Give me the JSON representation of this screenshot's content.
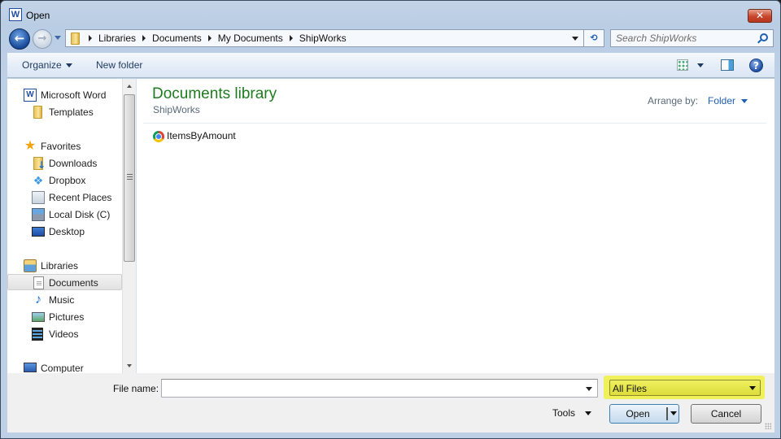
{
  "window": {
    "title": "Open",
    "app_icon": "word-icon",
    "close_label": "✕"
  },
  "navigation": {
    "back_label": "←",
    "forward_label": "→",
    "breadcrumb": [
      "Libraries",
      "Documents",
      "My Documents",
      "ShipWorks"
    ],
    "refresh_label": "⟲",
    "search_placeholder": "Search ShipWorks"
  },
  "toolbar": {
    "organize_label": "Organize",
    "new_folder_label": "New folder",
    "help_label": "?"
  },
  "nav_pane": {
    "items": [
      {
        "label": "Microsoft Word",
        "icon": "word-icon",
        "level": 0
      },
      {
        "label": "Templates",
        "icon": "folder-icon",
        "level": 1
      },
      {
        "label": "Favorites",
        "icon": "star-icon",
        "level": 0
      },
      {
        "label": "Downloads",
        "icon": "downloads-icon",
        "level": 1
      },
      {
        "label": "Dropbox",
        "icon": "dropbox-icon",
        "level": 1
      },
      {
        "label": "Recent Places",
        "icon": "recent-places-icon",
        "level": 1
      },
      {
        "label": "Local Disk (C)",
        "icon": "disk-icon",
        "level": 1
      },
      {
        "label": "Desktop",
        "icon": "desktop-icon",
        "level": 1
      },
      {
        "label": "Libraries",
        "icon": "libraries-icon",
        "level": 0
      },
      {
        "label": "Documents",
        "icon": "document-icon",
        "level": 1,
        "selected": true
      },
      {
        "label": "Music",
        "icon": "music-icon",
        "level": 1
      },
      {
        "label": "Pictures",
        "icon": "pictures-icon",
        "level": 1
      },
      {
        "label": "Videos",
        "icon": "videos-icon",
        "level": 1
      },
      {
        "label": "Computer",
        "icon": "computer-icon",
        "level": 0
      }
    ]
  },
  "content": {
    "library_title": "Documents library",
    "library_subtitle": "ShipWorks",
    "arrange_by_label": "Arrange by:",
    "arrange_by_value": "Folder",
    "files": [
      {
        "name": "ItemsByAmount",
        "icon": "chrome-icon"
      }
    ]
  },
  "footer": {
    "file_name_label": "File name:",
    "file_name_value": "",
    "file_type_value": "All Files",
    "tools_label": "Tools",
    "open_label": "Open",
    "cancel_label": "Cancel"
  },
  "colors": {
    "library_title": "#1e7b1e",
    "link_blue": "#1e5fb4",
    "filter_highlight": "#f0f05a"
  }
}
